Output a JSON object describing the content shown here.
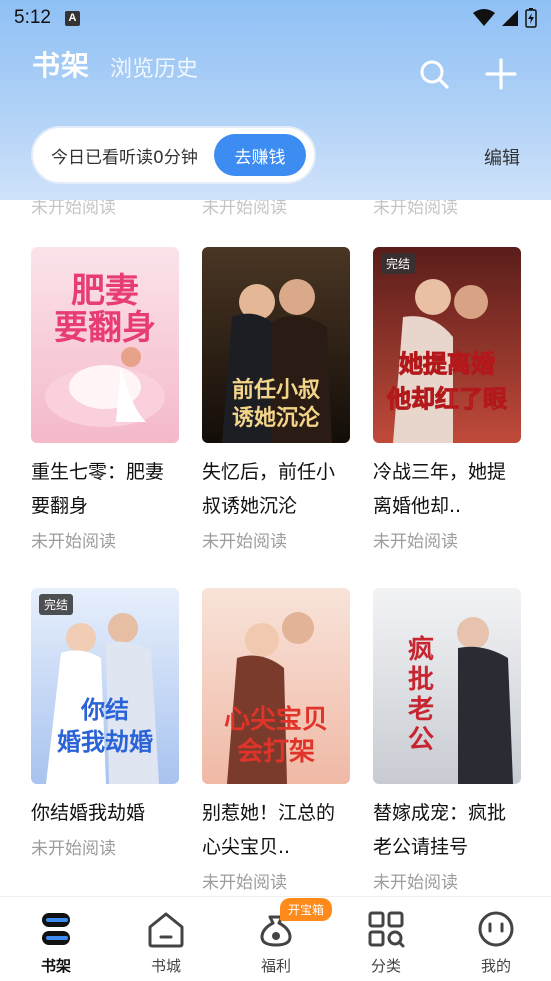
{
  "status_bar": {
    "time": "5:12",
    "notification_icon": "A"
  },
  "header": {
    "tab_shelf": "书架",
    "tab_history": "浏览历史",
    "search_icon": "search-icon",
    "add_icon": "plus-icon"
  },
  "reading_pill": {
    "text": "今日已看听读0分钟",
    "button": "去赚钱"
  },
  "edit": "编辑",
  "faded_status": [
    "未开始阅读",
    "未开始阅读",
    "未开始阅读"
  ],
  "books": [
    {
      "title": "重生七零：肥妻要翻身",
      "status": "未开始阅读",
      "badge": "",
      "cover_text": "肥妻要翻身",
      "cover_colors": [
        "#fbe3ea",
        "#f4b9c9",
        "#e83d74"
      ]
    },
    {
      "title": "失忆后，前任小叔诱她沉沦",
      "status": "未开始阅读",
      "badge": "",
      "cover_text": "前任小叔诱她沉沦",
      "cover_colors": [
        "#3a2a1c",
        "#1a120c",
        "#f3d58a"
      ]
    },
    {
      "title": "冷战三年，她提离婚他却..",
      "status": "未开始阅读",
      "badge": "完结",
      "cover_text": "她提离婚他却红了眼",
      "cover_colors": [
        "#7a2320",
        "#c04a3a",
        "#ffffff"
      ]
    },
    {
      "title": "你结婚我劫婚",
      "status": "未开始阅读",
      "badge": "完结",
      "cover_text": "你结婚我劫婚",
      "cover_colors": [
        "#dfe9fb",
        "#a8c3ef",
        "#2a62d8"
      ]
    },
    {
      "title": "别惹她！江总的心尖宝贝..",
      "status": "未开始阅读",
      "badge": "",
      "cover_text": "心尖宝贝会打架",
      "cover_colors": [
        "#f7dcd2",
        "#f0b9a6",
        "#e0342a"
      ]
    },
    {
      "title": "替嫁成宠：疯批老公请挂号",
      "status": "未开始阅读",
      "badge": "",
      "cover_text": "疯批老公请挂号",
      "cover_colors": [
        "#eceef0",
        "#c8ccd2",
        "#c7252f"
      ]
    }
  ],
  "nav": {
    "items": [
      {
        "label": "书架",
        "icon": "bookshelf-icon",
        "active": true
      },
      {
        "label": "书城",
        "icon": "bookstore-icon",
        "active": false
      },
      {
        "label": "福利",
        "icon": "money-bag-icon",
        "active": false
      },
      {
        "label": "分类",
        "icon": "category-grid-icon",
        "active": false
      },
      {
        "label": "我的",
        "icon": "profile-face-icon",
        "active": false
      }
    ],
    "treasure_badge": "开宝箱"
  }
}
